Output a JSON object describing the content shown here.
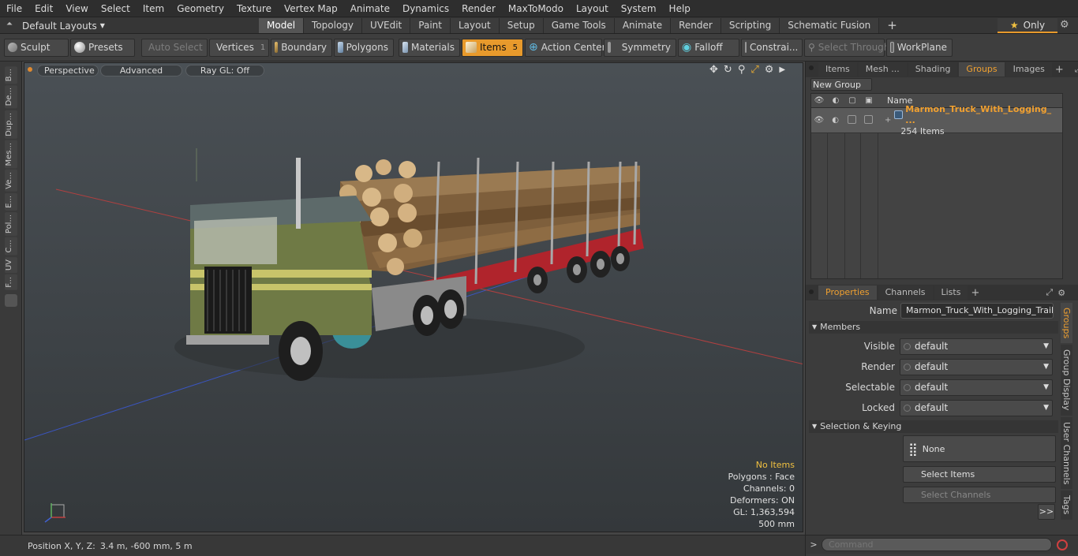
{
  "menubar": {
    "items": [
      "File",
      "Edit",
      "View",
      "Select",
      "Item",
      "Geometry",
      "Texture",
      "Vertex Map",
      "Animate",
      "Dynamics",
      "Render",
      "MaxToModo",
      "Layout",
      "System",
      "Help"
    ]
  },
  "layouts": {
    "dropdown": "Default Layouts",
    "tabs": [
      "Model",
      "Topology",
      "UVEdit",
      "Paint",
      "Layout",
      "Setup",
      "Game Tools",
      "Animate",
      "Render",
      "Scripting",
      "Schematic Fusion"
    ],
    "active": "Model",
    "plus": "+",
    "only": "Only"
  },
  "toolbar": {
    "sculpt": "Sculpt",
    "presets": "Presets",
    "auto_select": "Auto Select",
    "vertices": "Vertices",
    "vertices_count": "1",
    "boundary": "Boundary",
    "polygons": "Polygons",
    "materials": "Materials",
    "items": "Items",
    "items_count": "5",
    "action_center": "Action Center",
    "symmetry": "Symmetry",
    "falloff": "Falloff",
    "constraints": "Constrai...",
    "select_through": "Select Through",
    "workplane": "WorkPlane"
  },
  "left_strip": {
    "tabs": [
      "B...",
      "De...",
      "Dup...",
      "Mes...",
      "Ve...",
      "E...",
      "Pol...",
      "C...",
      "UV",
      "F..."
    ]
  },
  "viewport": {
    "perspective": "Perspective",
    "advanced": "Advanced",
    "raygl": "Ray GL: Off",
    "stats": {
      "no_items": "No Items",
      "polygons": "Polygons : Face",
      "channels": "Channels: 0",
      "deformers": "Deformers: ON",
      "gl": "GL: 1,363,594",
      "scale": "500 mm"
    },
    "colors": {
      "cab_green": "#6f7a45",
      "cab_yellow": "#c8c46a",
      "logs": "#8a6a42",
      "trailer_red": "#b0242c"
    }
  },
  "statusbar": {
    "label": "Position X, Y, Z:",
    "value": "3.4 m, -600 mm, 5 m"
  },
  "groups_panel": {
    "tabs": [
      "Items",
      "Mesh ...",
      "Shading",
      "Groups",
      "Images"
    ],
    "active": "Groups",
    "new_group": "New Group",
    "col_name": "Name",
    "group_name": "Marmon_Truck_With_Logging_ ...",
    "group_count": "254 Items"
  },
  "properties_panel": {
    "tabs": [
      "Properties",
      "Channels",
      "Lists"
    ],
    "active": "Properties",
    "name_label": "Name",
    "name_value": "Marmon_Truck_With_Logging_Trailer (",
    "members": "Members",
    "visible_label": "Visible",
    "visible_value": "default",
    "render_label": "Render",
    "render_value": "default",
    "selectable_label": "Selectable",
    "selectable_value": "default",
    "locked_label": "Locked",
    "locked_value": "default",
    "selection_keying": "Selection & Keying",
    "none": "None",
    "select_items": "Select Items",
    "select_channels": "Select Channels",
    "more": ">>",
    "side_tabs": [
      "Groups",
      "Group Display",
      "User Channels",
      "Tags"
    ]
  },
  "command": {
    "prompt": ">",
    "placeholder": "Command"
  }
}
